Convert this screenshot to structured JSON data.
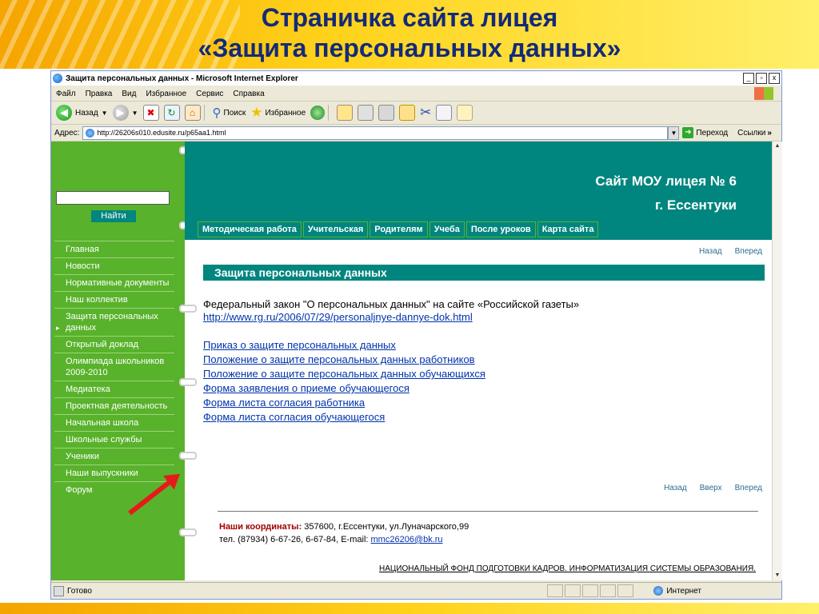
{
  "slide": {
    "title_line1": "Страничка сайта лицея",
    "title_line2": "«Защита персональных данных»"
  },
  "window": {
    "title": "Защита персональных данных - Microsoft Internet Explorer",
    "controls": [
      "_",
      "▫",
      "x"
    ]
  },
  "menu": [
    "Файл",
    "Правка",
    "Вид",
    "Избранное",
    "Сервис",
    "Справка"
  ],
  "toolbar": {
    "back": "Назад",
    "search": "Поиск",
    "favorites": "Избранное"
  },
  "address": {
    "label": "Адрес:",
    "url": "http://26206s010.edusite.ru/p65aa1.html",
    "go": "Переход",
    "links": "Ссылки"
  },
  "site": {
    "title": "Сайт МОУ лицея № 6",
    "city": "г. Ессентуки",
    "search_button": "Найти",
    "topnav": [
      "Методическая работа",
      "Учительская",
      "Родителям",
      "Учеба",
      "После уроков",
      "Карта сайта"
    ],
    "sidebar": [
      "Главная",
      "Новости",
      "Нормативные документы",
      "Наш коллектив",
      "Защита персональных данных",
      "Открытый доклад",
      "Олимпиада школьников 2009-2010",
      "Медиатека",
      "Проектная деятельность",
      "Начальная школа",
      "Школьные службы",
      "Ученики",
      "Наши выпускники",
      "Форум"
    ],
    "nav_top": {
      "back": "Назад",
      "forward": "Вперед"
    },
    "nav_bottom": {
      "back": "Назад",
      "up": "Вверх",
      "forward": "Вперед"
    },
    "section_title": "Защита персональных данных",
    "law_text": "Федеральный закон \"О персональных данных\" на сайте «Российской газеты»",
    "law_link": "http://www.rg.ru/2006/07/29/personaljnye-dannye-dok.html",
    "documents": [
      "Приказ о защите персональных данных",
      "Положение о защите персональных данных работников",
      "Положение о защите персональных данных обучающихся",
      "Форма заявления о приеме обучающегося",
      "Форма листа согласия работника",
      "Форма листа согласия обучающегося"
    ],
    "footer": {
      "coords_label": "Наши координаты:",
      "coords": " 357600, г.Ессентуки, ул.Луначарского,99",
      "phone": "тел. (87934) 6-67-26, 6-67-84, E-mail: ",
      "email": "mmc26206@bk.ru",
      "bottom_line": "НАЦИОНАЛЬНЫЙ ФОНД ПОДГОТОВКИ КАДРОВ. ИНФОРМАТИЗАЦИЯ СИСТЕМЫ ОБРАЗОВАНИЯ."
    }
  },
  "status": {
    "text": "Готово",
    "zone": "Интернет"
  },
  "colors": {
    "accent_teal": "#00867e",
    "sidebar_green": "#59b22b",
    "title_blue": "#142a78",
    "arrow_red": "#e61a1a"
  }
}
